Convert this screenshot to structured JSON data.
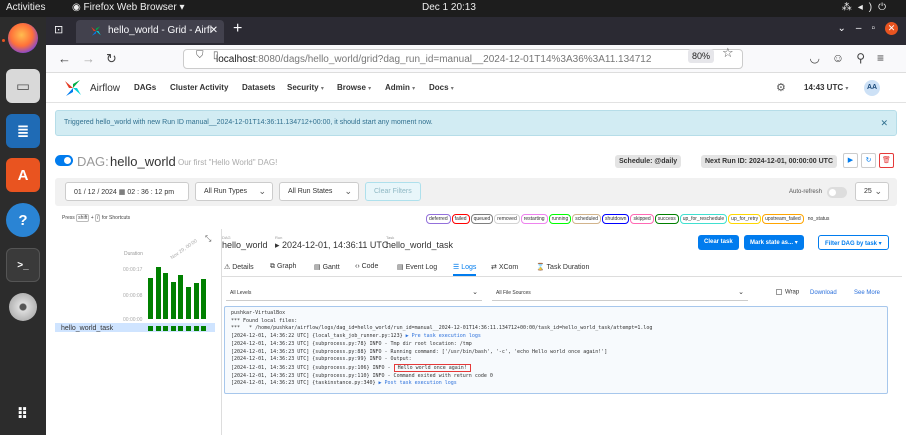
{
  "system": {
    "activities": "Activities",
    "app": "Firefox Web Browser",
    "clock": "Dec 1  20:13"
  },
  "browser": {
    "tab_title": "hello_world - Grid - Airfl",
    "url_host": "localhost",
    "url_rest": ":8080/dags/hello_world/grid?dag_run_id=manual__2024-12-01T14%3A36%3A11.134712",
    "zoom": "80%"
  },
  "airflow_nav": {
    "brand": "Airflow",
    "menus": [
      "DAGs",
      "Cluster Activity",
      "Datasets",
      "Security",
      "Browse",
      "Admin",
      "Docs"
    ],
    "time": "14:43 UTC",
    "user_initials": "AA"
  },
  "flash": "Triggered hello_world with new Run ID manual__2024-12-01T14:36:11.134712+00:00, it should start any moment now.",
  "dag": {
    "label": "DAG:",
    "name": "hello_world",
    "description": "Our first \"Hello World\" DAG!",
    "schedule": "Schedule: @daily",
    "next_run": "Next Run ID: 2024-12-01, 00:00:00 UTC"
  },
  "filters": {
    "date": "01 / 12 / 2024",
    "time": "02 : 36 : 12  pm",
    "run_types": "All Run Types",
    "run_states": "All Run States",
    "clear": "Clear Filters",
    "auto_refresh": "Auto-refresh",
    "count": "25"
  },
  "shortcuts": {
    "press": "Press",
    "key": "shift",
    "plus": "+",
    "slash": "/",
    "for": "for Shortcuts"
  },
  "states": [
    {
      "label": "deferred",
      "color": "#9370db"
    },
    {
      "label": "failed",
      "color": "#ff0000"
    },
    {
      "label": "queued",
      "color": "#808080"
    },
    {
      "label": "removed",
      "color": "#d3d3d3"
    },
    {
      "label": "restarting",
      "color": "#ee82ee"
    },
    {
      "label": "running",
      "color": "#00ff00"
    },
    {
      "label": "scheduled",
      "color": "#d2b48c"
    },
    {
      "label": "shutdown",
      "color": "#0000ff"
    },
    {
      "label": "skipped",
      "color": "#ff69b4"
    },
    {
      "label": "success",
      "color": "#008000"
    },
    {
      "label": "up_for_reschedule",
      "color": "#40e0d0"
    },
    {
      "label": "up_for_retry",
      "color": "#ffd700"
    },
    {
      "label": "upstream_failed",
      "color": "#ffa500"
    },
    {
      "label": "no_status",
      "color": "#ffffff"
    }
  ],
  "grid": {
    "duration_label": "Duration",
    "ticks": [
      "00:00:17",
      "00:00:08",
      "00:00:00"
    ],
    "date_label": "Nov 29, 00:00",
    "task": "hello_world_task",
    "bar_heights": [
      0.78,
      1.0,
      0.88,
      0.72,
      0.85,
      0.62,
      0.7,
      0.76
    ],
    "cell_count": 8
  },
  "details": {
    "crumbs": [
      {
        "label": "DAG",
        "value": "hello_world"
      },
      {
        "label": "Run",
        "value": "▸ 2024-12-01, 14:36:11 UTC"
      },
      {
        "label": "Task",
        "value": "hello_world_task"
      }
    ],
    "actions": {
      "clear": "Clear task",
      "mark": "Mark state as... ▾",
      "filter": "Filter DAG by task ▾"
    },
    "tabs": [
      "Details",
      "Graph",
      "Gantt",
      "Code",
      "Event Log",
      "Logs",
      "XCom",
      "Task Duration"
    ],
    "level_select": "All Levels",
    "source_select": "All File Sources",
    "wrap": "Wrap",
    "download": "Download",
    "see_more": "See More"
  },
  "log": {
    "line1": "pushkar-VirtualBox",
    "line2": "*** Found local files:",
    "line3": "***   * /home/pushkar/airflow/logs/dag_id=hello_world/run_id=manual__2024-12-01T14:36:11.134712+00:00/task_id=hello_world_task/attempt=1.log",
    "line4a": "[2024-12-01, 14:36:22 UTC] {local_task_job_runner.py:123} ",
    "line4b": "▶ Pre task execution logs",
    "line5": "[2024-12-01, 14:36:23 UTC] {subprocess.py:78} INFO - Tmp dir root location: /tmp",
    "line6": "[2024-12-01, 14:36:23 UTC] {subprocess.py:88} INFO - Running command: ['/usr/bin/bash', '-c', 'echo Hello world once again!']",
    "line7": "[2024-12-01, 14:36:23 UTC] {subprocess.py:99} INFO - Output:",
    "line8a": "[2024-12-01, 14:36:23 UTC] {subprocess.py:106} INFO - ",
    "line8b": "Hello world once again!",
    "line9": "[2024-12-01, 14:36:23 UTC] {subprocess.py:110} INFO - Command exited with return code 0",
    "line10a": "[2024-12-01, 14:36:23 UTC] {taskinstance.py:340} ",
    "line10b": "▶ Post task execution logs"
  }
}
